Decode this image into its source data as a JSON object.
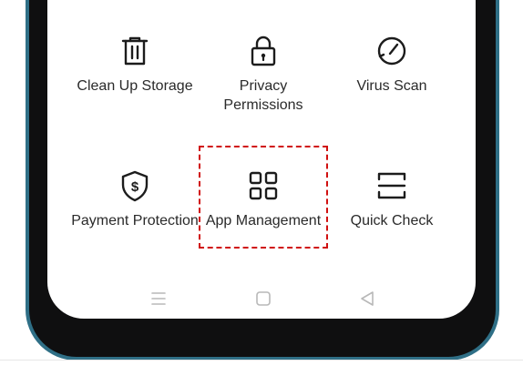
{
  "grid": {
    "row1": [
      {
        "label": "Clean Up Storage",
        "icon": "trash-icon"
      },
      {
        "label": "Privacy\nPermissions",
        "icon": "lock-icon"
      },
      {
        "label": "Virus Scan",
        "icon": "virus-scan-gauge-icon"
      }
    ],
    "row2": [
      {
        "label": "Payment Protection",
        "icon": "shield-dollar-icon"
      },
      {
        "label": "App Management",
        "icon": "grid-apps-icon"
      },
      {
        "label": "Quick Check",
        "icon": "scan-frame-icon"
      }
    ]
  },
  "navbar": {
    "menu_icon": "menu-icon",
    "home_icon": "home-square-icon",
    "back_icon": "back-triangle-icon"
  },
  "colors": {
    "highlight": "#d01010",
    "frame_accent": "#2f6f86",
    "icon_stroke": "#1c1c1c",
    "label_text": "#2a2a2a"
  }
}
